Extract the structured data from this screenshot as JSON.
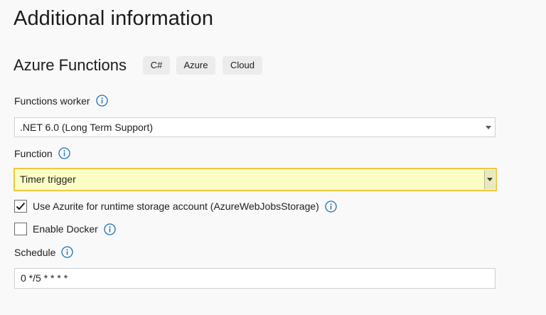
{
  "page": {
    "title": "Additional information"
  },
  "template": {
    "name": "Azure Functions",
    "tags": [
      "C#",
      "Azure",
      "Cloud"
    ]
  },
  "functions_worker": {
    "label": "Functions worker",
    "selected": ".NET 6.0 (Long Term Support)"
  },
  "function": {
    "label": "Function",
    "selected": "Timer trigger"
  },
  "azurite": {
    "label": "Use Azurite for runtime storage account (AzureWebJobsStorage)",
    "checked": true
  },
  "docker": {
    "label": "Enable Docker",
    "checked": false
  },
  "schedule": {
    "label": "Schedule",
    "value": "0 */5 * * * *"
  },
  "colors": {
    "info_icon": "#1a6fb5",
    "focus_border": "#f0c842",
    "focus_fill": "#fdfdc6",
    "tag_bg": "#ececec"
  },
  "icons": {
    "info": "info-circle-icon",
    "dropdown": "caret-down-icon",
    "check": "checkmark-icon"
  }
}
